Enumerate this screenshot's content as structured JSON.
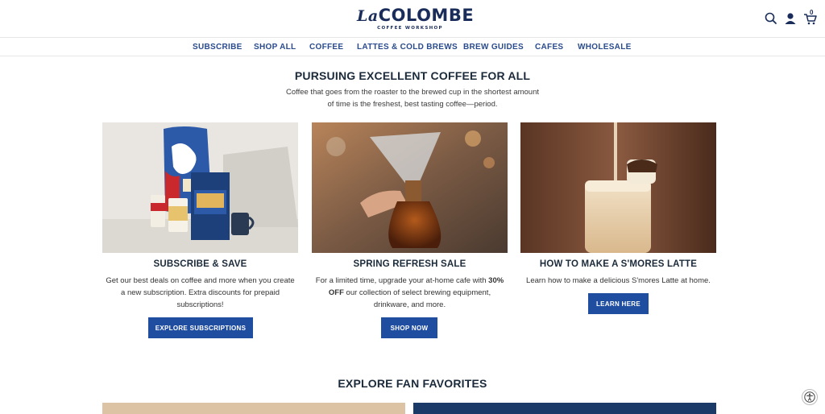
{
  "brand": {
    "logo_main": "COLOMBE",
    "logo_prefix": "La",
    "logo_sub": "COFFEE WORKSHOP"
  },
  "header_icons": {
    "search": "search-icon",
    "account": "user-icon",
    "cart": "cart-icon",
    "cart_count": "0"
  },
  "nav": {
    "items": [
      {
        "label": "SUBSCRIBE"
      },
      {
        "label": "SHOP ALL"
      },
      {
        "label": "COFFEE"
      },
      {
        "label": "LATTES & COLD BREWS"
      },
      {
        "label": "BREW GUIDES"
      },
      {
        "label": "CAFES"
      },
      {
        "label": "WHOLESALE"
      }
    ]
  },
  "hero": {
    "title": "PURSUING EXCELLENT COFFEE FOR ALL",
    "subtitle_line1": "Coffee that goes from the roaster to the brewed cup in the shortest amount",
    "subtitle_line2": "of time is the freshest, best tasting coffee—period."
  },
  "cards": [
    {
      "title": "SUBSCRIBE & SAVE",
      "text_line1": "Get our best deals on coffee and more when you create",
      "text_line2": "a new subscription. Extra discounts for prepaid",
      "text_line3": "subscriptions!",
      "button": "EXPLORE SUBSCRIPTIONS"
    },
    {
      "title": "SPRING REFRESH SALE",
      "text_line1a": "For a limited time, upgrade your at-home cafe with ",
      "text_line1b": "30%",
      "text_line2a": "OFF",
      "text_line2b": " our collection of select brewing equipment,",
      "text_line3": "drinkware, and more.",
      "button": "SHOP NOW"
    },
    {
      "title": "HOW TO MAKE A S'MORES LATTE",
      "text_line1": "Learn how to make a delicious S'mores Latte at home.",
      "button": "LEARN HERE"
    }
  ],
  "favorites": {
    "title": "EXPLORE FAN FAVORITES"
  },
  "accessibility": {
    "icon": "accessibility-icon"
  },
  "colors": {
    "brand_navy": "#1a2d5a",
    "nav_blue": "#2a4b8d",
    "button_blue": "#1f4da0"
  }
}
